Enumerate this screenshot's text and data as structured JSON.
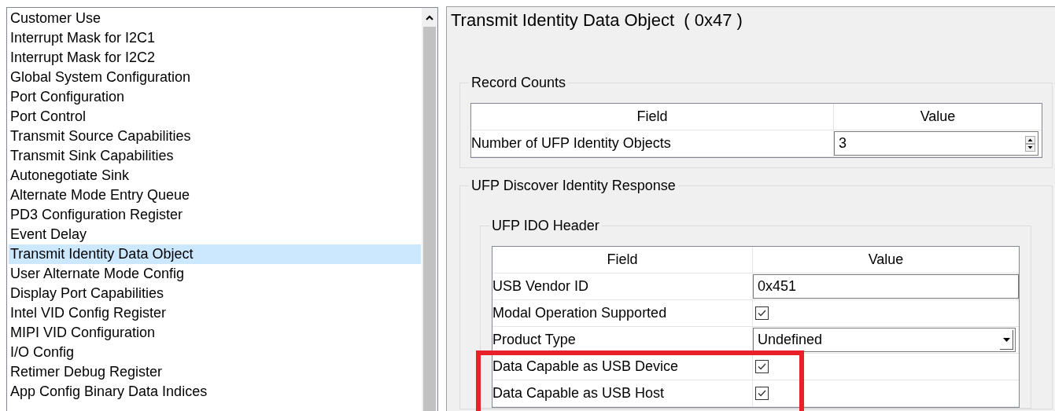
{
  "register_list": {
    "items": [
      {
        "label": "Customer Use",
        "selected": false
      },
      {
        "label": "Interrupt Mask for I2C1",
        "selected": false
      },
      {
        "label": "Interrupt Mask for I2C2",
        "selected": false
      },
      {
        "label": "Global System Configuration",
        "selected": false
      },
      {
        "label": "Port Configuration",
        "selected": false
      },
      {
        "label": "Port Control",
        "selected": false
      },
      {
        "label": "Transmit Source Capabilities",
        "selected": false
      },
      {
        "label": "Transmit Sink Capabilities",
        "selected": false
      },
      {
        "label": "Autonegotiate Sink",
        "selected": false
      },
      {
        "label": "Alternate Mode Entry Queue",
        "selected": false
      },
      {
        "label": "PD3 Configuration Register",
        "selected": false
      },
      {
        "label": "Event Delay",
        "selected": false
      },
      {
        "label": "Transmit Identity Data Object",
        "selected": true
      },
      {
        "label": "User Alternate Mode Config",
        "selected": false
      },
      {
        "label": "Display Port Capabilities",
        "selected": false
      },
      {
        "label": "Intel VID Config Register",
        "selected": false
      },
      {
        "label": "MIPI VID Configuration",
        "selected": false
      },
      {
        "label": "I/O Config",
        "selected": false
      },
      {
        "label": "Retimer Debug Register",
        "selected": false
      },
      {
        "label": "App Config Binary Data Indices",
        "selected": false
      }
    ]
  },
  "detail": {
    "title": "Transmit Identity Data Object  ( 0x47 )",
    "record_counts": {
      "legend": "Record Counts",
      "columns": [
        "Field",
        "Value"
      ],
      "rows": [
        {
          "field": "Number of UFP Identity Objects",
          "kind": "spinner",
          "value": "3"
        }
      ]
    },
    "discover_identity": {
      "legend": "UFP Discover Identity Response",
      "ido_header": {
        "legend": "UFP IDO Header",
        "columns": [
          "Field",
          "Value"
        ],
        "rows": [
          {
            "field": "USB Vendor ID",
            "kind": "text",
            "value": "0x451",
            "highlighted": false
          },
          {
            "field": "Modal Operation Supported",
            "kind": "checkbox",
            "checked": true,
            "highlighted": false
          },
          {
            "field": "Product Type",
            "kind": "dropdown",
            "value": "Undefined",
            "highlighted": false
          },
          {
            "field": "Data Capable as USB Device",
            "kind": "checkbox",
            "checked": true,
            "highlighted": true
          },
          {
            "field": "Data Capable as USB Host",
            "kind": "checkbox",
            "checked": true,
            "highlighted": true
          }
        ]
      }
    }
  }
}
